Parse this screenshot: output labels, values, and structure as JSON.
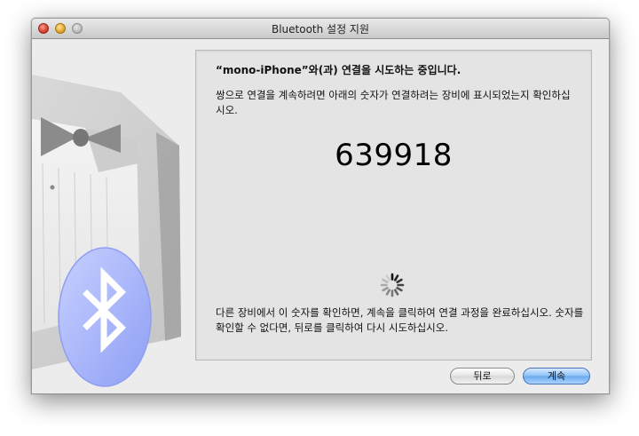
{
  "window": {
    "title": "Bluetooth 설정 지원"
  },
  "content": {
    "heading": "“mono-iPhone”와(과) 연결을 시도하는 중입니다.",
    "instruction": "쌍으로 연결을 계속하려면 아래의 숫자가 연결하려는 장비에 표시되었는지 확인하십시오.",
    "passkey": "639918",
    "footer_text": "다른 장비에서 이 숫자를 확인하면, 계속을 클릭하여 연결 과정을 완료하십시오. 숫자를 확인할 수 없다면, 뒤로를 클릭하여 다시 시도하십시오."
  },
  "buttons": {
    "back": "뒤로",
    "continue": "계속"
  },
  "icons": {
    "art": "tuxedo-butler-icon",
    "bluetooth": "bluetooth-icon",
    "spinner": "progress-spinner-icon"
  },
  "colors": {
    "default_button": "#6aa9ee",
    "bluetooth_badge": "#a9b8ff"
  }
}
